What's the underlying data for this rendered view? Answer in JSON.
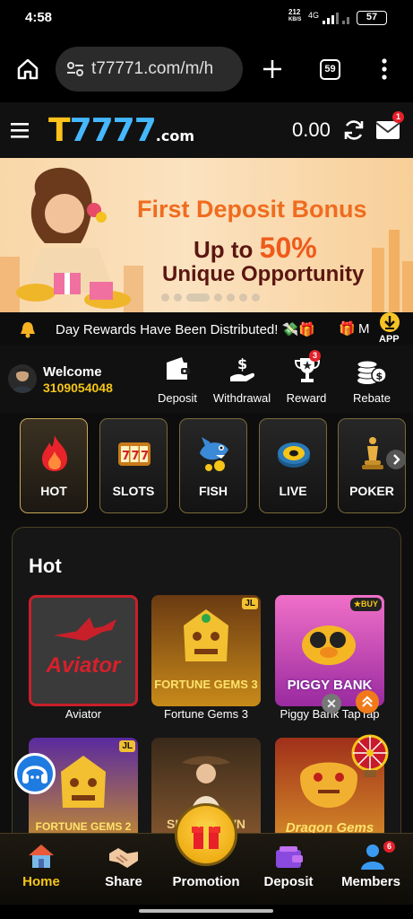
{
  "status_bar": {
    "time": "4:58",
    "speed_value": "212",
    "speed_unit": "KB/S",
    "network": "4G",
    "battery": "57"
  },
  "browser": {
    "url": "t77771.com/m/h",
    "tab_count": "59"
  },
  "header": {
    "logo_prefix": "T",
    "logo_digits": "7777",
    "logo_suffix": ".com",
    "balance": "0.00",
    "mail_badge": "1"
  },
  "banner": {
    "line1": "First Deposit Bonus",
    "line2_prefix": "Up to",
    "line2_percent": "50%",
    "line3": "Unique Opportunity",
    "active_slide": 3,
    "slide_count": 7
  },
  "marquee": {
    "message": "Day Rewards Have Been Distributed! 💸🎁",
    "app_label": "APP"
  },
  "user": {
    "welcome": "Welcome",
    "id": "3109054048"
  },
  "actions": [
    {
      "label": "Deposit",
      "icon": "wallet-icon"
    },
    {
      "label": "Withdrawal",
      "icon": "withdraw-icon"
    },
    {
      "label": "Reward",
      "icon": "trophy-icon",
      "badge": "3"
    },
    {
      "label": "Rebate",
      "icon": "coins-icon"
    }
  ],
  "categories": [
    {
      "label": "HOT",
      "icon": "flame-icon",
      "active": true
    },
    {
      "label": "SLOTS",
      "icon": "slots-777-icon",
      "active": false
    },
    {
      "label": "FISH",
      "icon": "fish-icon",
      "active": false
    },
    {
      "label": "LIVE",
      "icon": "roulette-icon",
      "active": false
    },
    {
      "label": "POKER",
      "icon": "chess-icon",
      "active": false
    }
  ],
  "hot": {
    "title": "Hot",
    "games": [
      {
        "name": "Aviator",
        "art_text": "Aviator",
        "color": "#c8202a"
      },
      {
        "name": "Fortune Gems 3",
        "art_text": "FORTUNE GEMS 3",
        "color": "#e0a020"
      },
      {
        "name": "Piggy Bank TapTap",
        "art_text": "PIGGY BANK",
        "color": "#d040c0"
      },
      {
        "name": "",
        "art_text": "FORTUNE GEMS 2",
        "color": "#6030a0"
      },
      {
        "name": "",
        "art_text": "SHOWDOWN",
        "color": "#8a5a30"
      },
      {
        "name": "",
        "art_text": "Dragon Gems",
        "color": "#c0801a"
      }
    ]
  },
  "bottom_nav": [
    {
      "label": "Home",
      "icon": "home-icon",
      "active": true
    },
    {
      "label": "Share",
      "icon": "handshake-icon",
      "active": false
    },
    {
      "label": "Promotion",
      "icon": "gift-icon",
      "active": false
    },
    {
      "label": "Deposit",
      "icon": "deposit-wallet-icon",
      "active": false
    },
    {
      "label": "Members",
      "icon": "members-icon",
      "active": false,
      "badge": "6"
    }
  ]
}
